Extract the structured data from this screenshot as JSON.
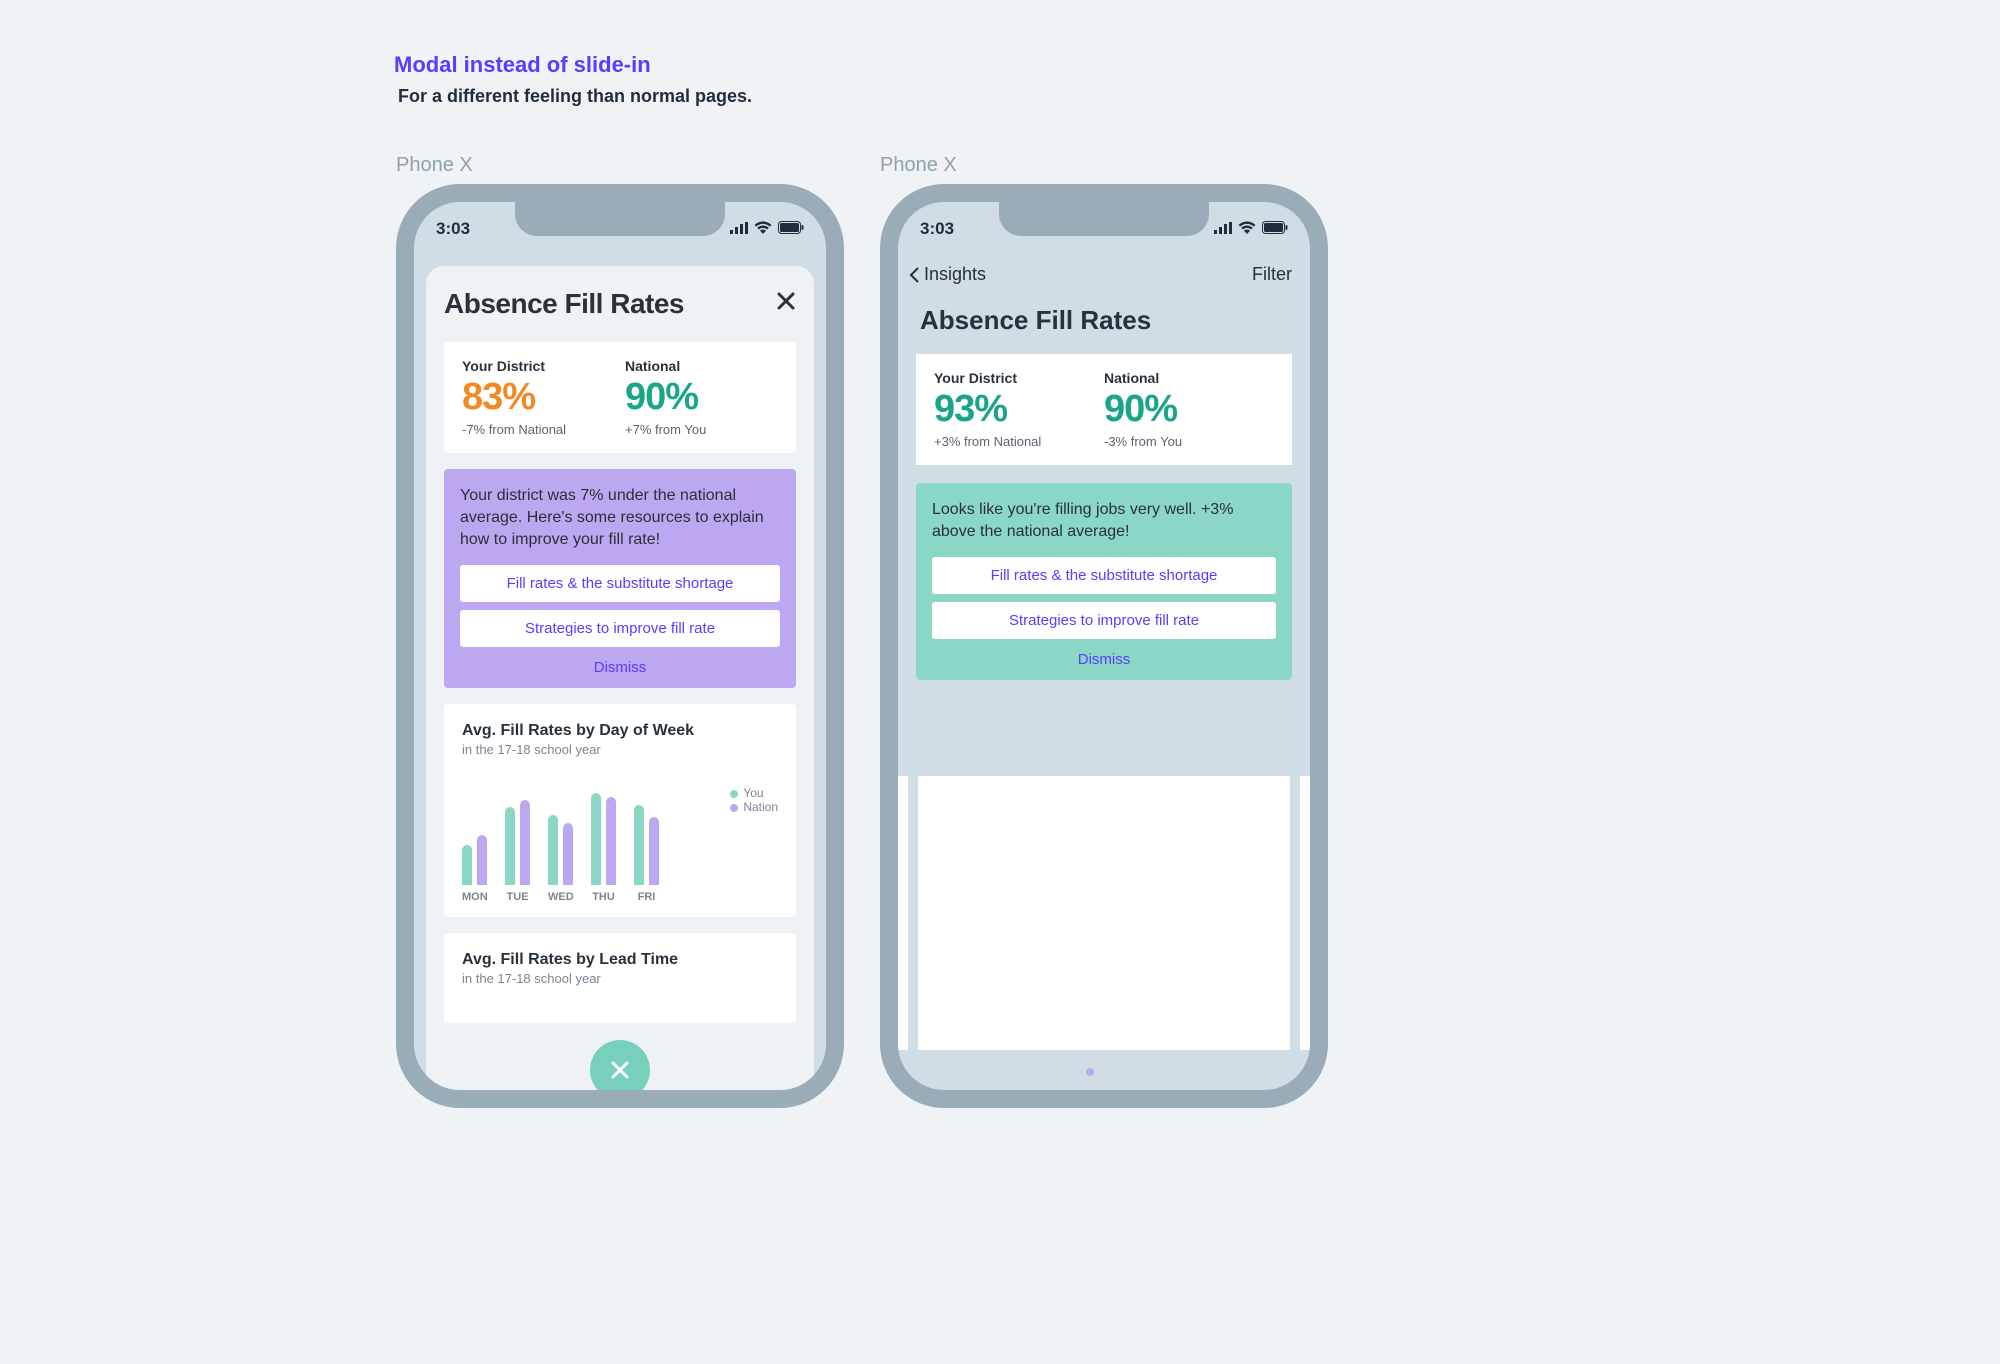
{
  "annotation": {
    "title": "Modal instead of slide-in",
    "subtitle": "For a different feeling than normal pages."
  },
  "frame_labels": {
    "left": "Phone X",
    "right": "Phone X"
  },
  "status_time": "3:03",
  "colors": {
    "orange": "#f08a24",
    "teal": "#1aa58a",
    "purple_card": "#bba8f0",
    "mint_card": "#8ad7c5",
    "link": "#5b3bff"
  },
  "left": {
    "title": "Absence Fill Rates",
    "stats": {
      "district": {
        "label": "Your District",
        "value": "83%",
        "sub": "-7% from National"
      },
      "national": {
        "label": "National",
        "value": "90%",
        "sub": "+7% from You"
      }
    },
    "info": {
      "text": "Your district was 7% under the national average. Here's some resources to explain how to improve your fill rate!",
      "btn1": "Fill rates & the substitute shortage",
      "btn2": "Strategies to improve fill rate",
      "dismiss": "Dismiss"
    },
    "chart1": {
      "title": "Avg. Fill Rates by Day of Week",
      "sub": "in the 17-18 school year",
      "legend": {
        "you": "You",
        "nation": "Nation"
      }
    },
    "chart2": {
      "title": "Avg. Fill Rates by Lead Time",
      "sub": "in the 17-18 school year"
    }
  },
  "right": {
    "nav": {
      "back": "Insights",
      "filter": "Filter"
    },
    "title": "Absence Fill Rates",
    "stats": {
      "district": {
        "label": "Your District",
        "value": "93%",
        "sub": "+3% from National"
      },
      "national": {
        "label": "National",
        "value": "90%",
        "sub": "-3% from You"
      }
    },
    "info": {
      "text": "Looks like you're filling jobs very well. +3% above the national average!",
      "btn1": "Fill rates & the substitute shortage",
      "btn2": "Strategies to improve fill rate",
      "dismiss": "Dismiss"
    }
  },
  "chart_data": {
    "type": "bar",
    "title": "Avg. Fill Rates by Day of Week",
    "subtitle": "in the 17-18 school year",
    "categories": [
      "MON",
      "TUE",
      "WED",
      "THU",
      "FRI"
    ],
    "series": [
      {
        "name": "You",
        "values": [
          40,
          78,
          70,
          92,
          80
        ]
      },
      {
        "name": "Nation",
        "values": [
          50,
          85,
          62,
          88,
          68
        ]
      }
    ],
    "ylim": [
      0,
      100
    ],
    "xlabel": "",
    "ylabel": ""
  }
}
